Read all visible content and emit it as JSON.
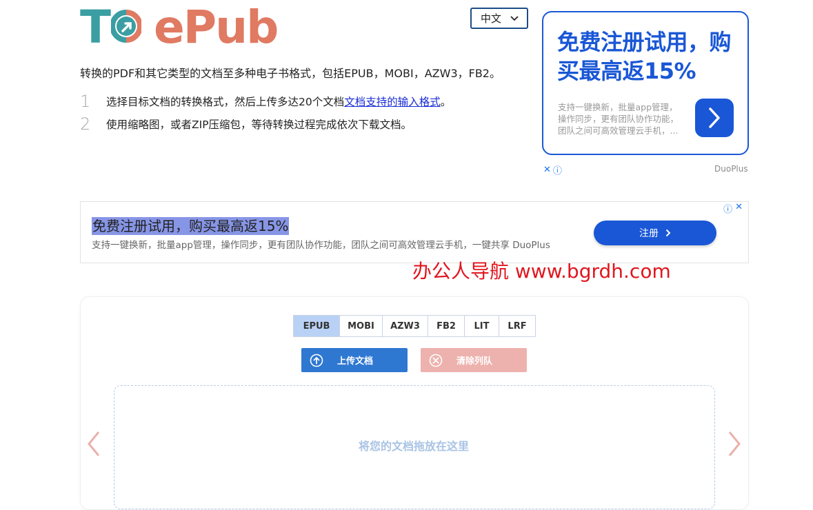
{
  "logo": {
    "part1": "T",
    "part2": "ePub",
    "colors": {
      "teal": "#3a9ea3",
      "coral": "#e07a62"
    }
  },
  "language": {
    "selected": "中文"
  },
  "description": "转换的PDF和其它类型的文档至多种电子书格式，包括EPUB，MOBI，AZW3，FB2。",
  "steps": [
    {
      "num": "1",
      "text_before": "选择目标文档的转换格式，然后上传多达20个文档",
      "link": "文档支持的输入格式",
      "text_after": "。"
    },
    {
      "num": "2",
      "text": "使用缩略图，或者ZIP压缩包，等待转换过程完成依次下载文档。"
    }
  ],
  "ad_card": {
    "title": "免费注册试用，购买最高返15%",
    "body": "支持一键换新，批量app管理，操作同步，更有团队协作功能，团队之间可高效管理云手机，...",
    "brand": "DuoPlus",
    "accent": "#1a57d6"
  },
  "banner_ad": {
    "title": "免费注册试用，购买最高返15%",
    "subtitle": "支持一键换新，批量app管理，操作同步，更有团队协作功能，团队之间可高效管理云手机，一键共享 DuoPlus",
    "button": "注册"
  },
  "watermark": "办公人导航 www.bgrdh.com",
  "formats": [
    "EPUB",
    "MOBI",
    "AZW3",
    "FB2",
    "LIT",
    "LRF"
  ],
  "active_format": "EPUB",
  "buttons": {
    "upload": "上传文档",
    "clear": "清除列队"
  },
  "dropzone_text": "将您的文档拖放在这里"
}
